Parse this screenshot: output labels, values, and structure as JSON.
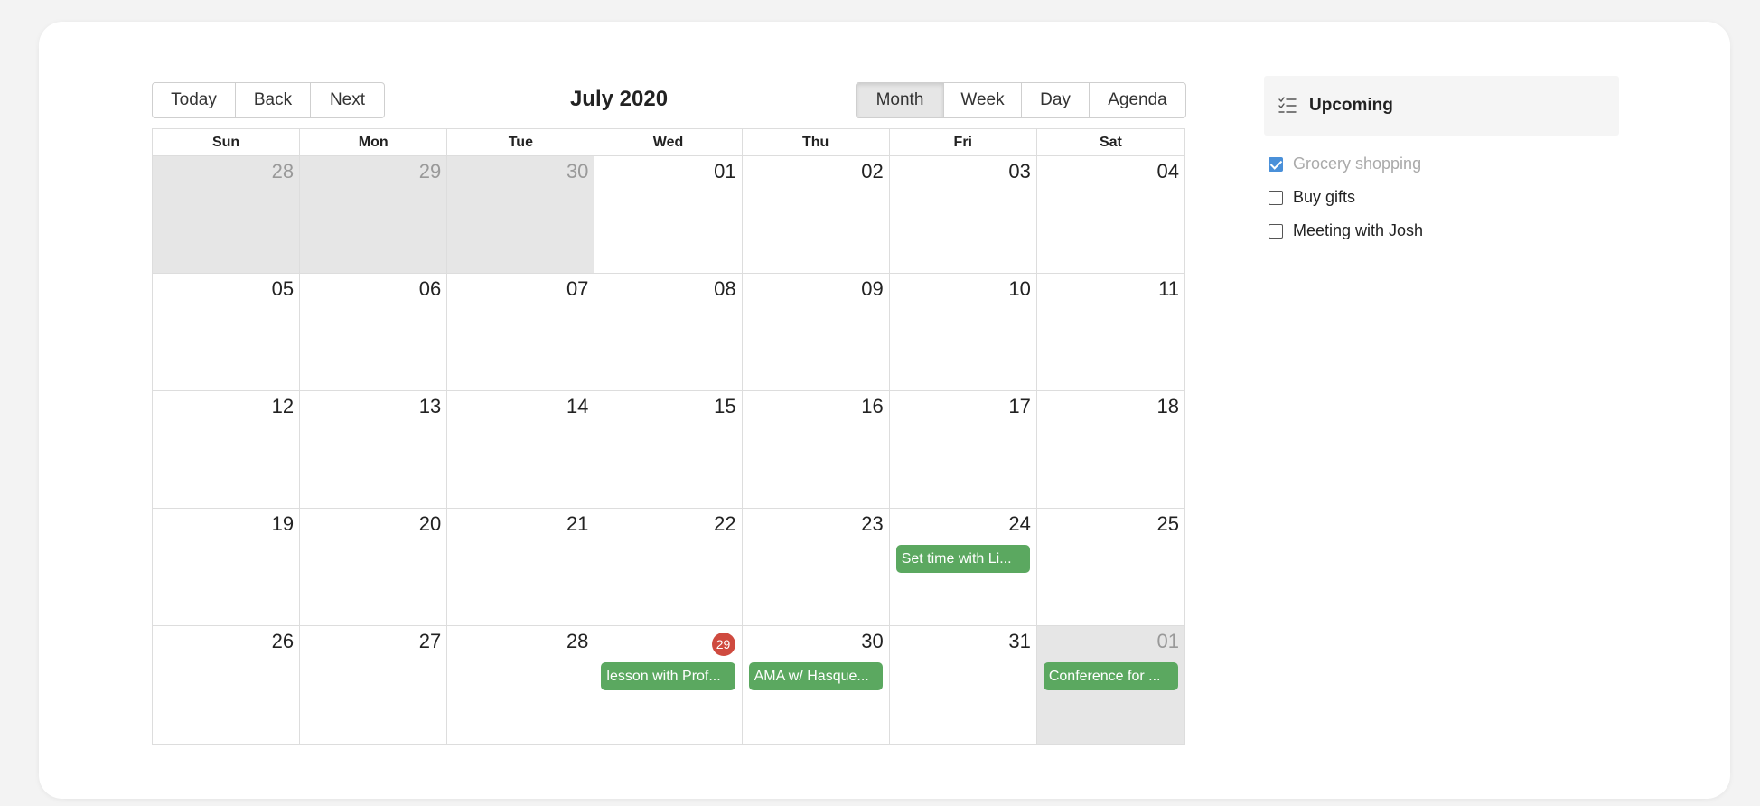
{
  "toolbar": {
    "nav_buttons": [
      "Today",
      "Back",
      "Next"
    ],
    "title": "July 2020",
    "view_buttons": [
      "Month",
      "Week",
      "Day",
      "Agenda"
    ],
    "active_view": "Month"
  },
  "calendar": {
    "weekdays": [
      "Sun",
      "Mon",
      "Tue",
      "Wed",
      "Thu",
      "Fri",
      "Sat"
    ],
    "today_marker": "29",
    "weeks": [
      [
        {
          "day": "28",
          "off": true
        },
        {
          "day": "29",
          "off": true
        },
        {
          "day": "30",
          "off": true
        },
        {
          "day": "01",
          "off": false
        },
        {
          "day": "02",
          "off": false
        },
        {
          "day": "03",
          "off": false
        },
        {
          "day": "04",
          "off": false
        }
      ],
      [
        {
          "day": "05",
          "off": false
        },
        {
          "day": "06",
          "off": false
        },
        {
          "day": "07",
          "off": false
        },
        {
          "day": "08",
          "off": false
        },
        {
          "day": "09",
          "off": false
        },
        {
          "day": "10",
          "off": false
        },
        {
          "day": "11",
          "off": false
        }
      ],
      [
        {
          "day": "12",
          "off": false
        },
        {
          "day": "13",
          "off": false
        },
        {
          "day": "14",
          "off": false
        },
        {
          "day": "15",
          "off": false
        },
        {
          "day": "16",
          "off": false
        },
        {
          "day": "17",
          "off": false
        },
        {
          "day": "18",
          "off": false
        }
      ],
      [
        {
          "day": "19",
          "off": false
        },
        {
          "day": "20",
          "off": false
        },
        {
          "day": "21",
          "off": false
        },
        {
          "day": "22",
          "off": false
        },
        {
          "day": "23",
          "off": false
        },
        {
          "day": "24",
          "off": false,
          "event": "Set time with Li..."
        },
        {
          "day": "25",
          "off": false
        }
      ],
      [
        {
          "day": "26",
          "off": false
        },
        {
          "day": "27",
          "off": false
        },
        {
          "day": "28",
          "off": false
        },
        {
          "day": "29",
          "off": false,
          "today": true,
          "event": "lesson with Prof..."
        },
        {
          "day": "30",
          "off": false,
          "event": "AMA w/ Hasque..."
        },
        {
          "day": "31",
          "off": false
        },
        {
          "day": "01",
          "off": true,
          "event": "Conference for ..."
        }
      ]
    ]
  },
  "upcoming": {
    "title": "Upcoming",
    "icon": "checklist-icon",
    "items": [
      {
        "label": "Grocery shopping",
        "checked": true
      },
      {
        "label": "Buy gifts",
        "checked": false
      },
      {
        "label": "Meeting with Josh",
        "checked": false
      }
    ]
  },
  "colors": {
    "event": "#5ba860",
    "today_badge": "#cf4a3f",
    "off_range": "#e6e6e6",
    "checkbox_checked": "#4a90d9"
  }
}
